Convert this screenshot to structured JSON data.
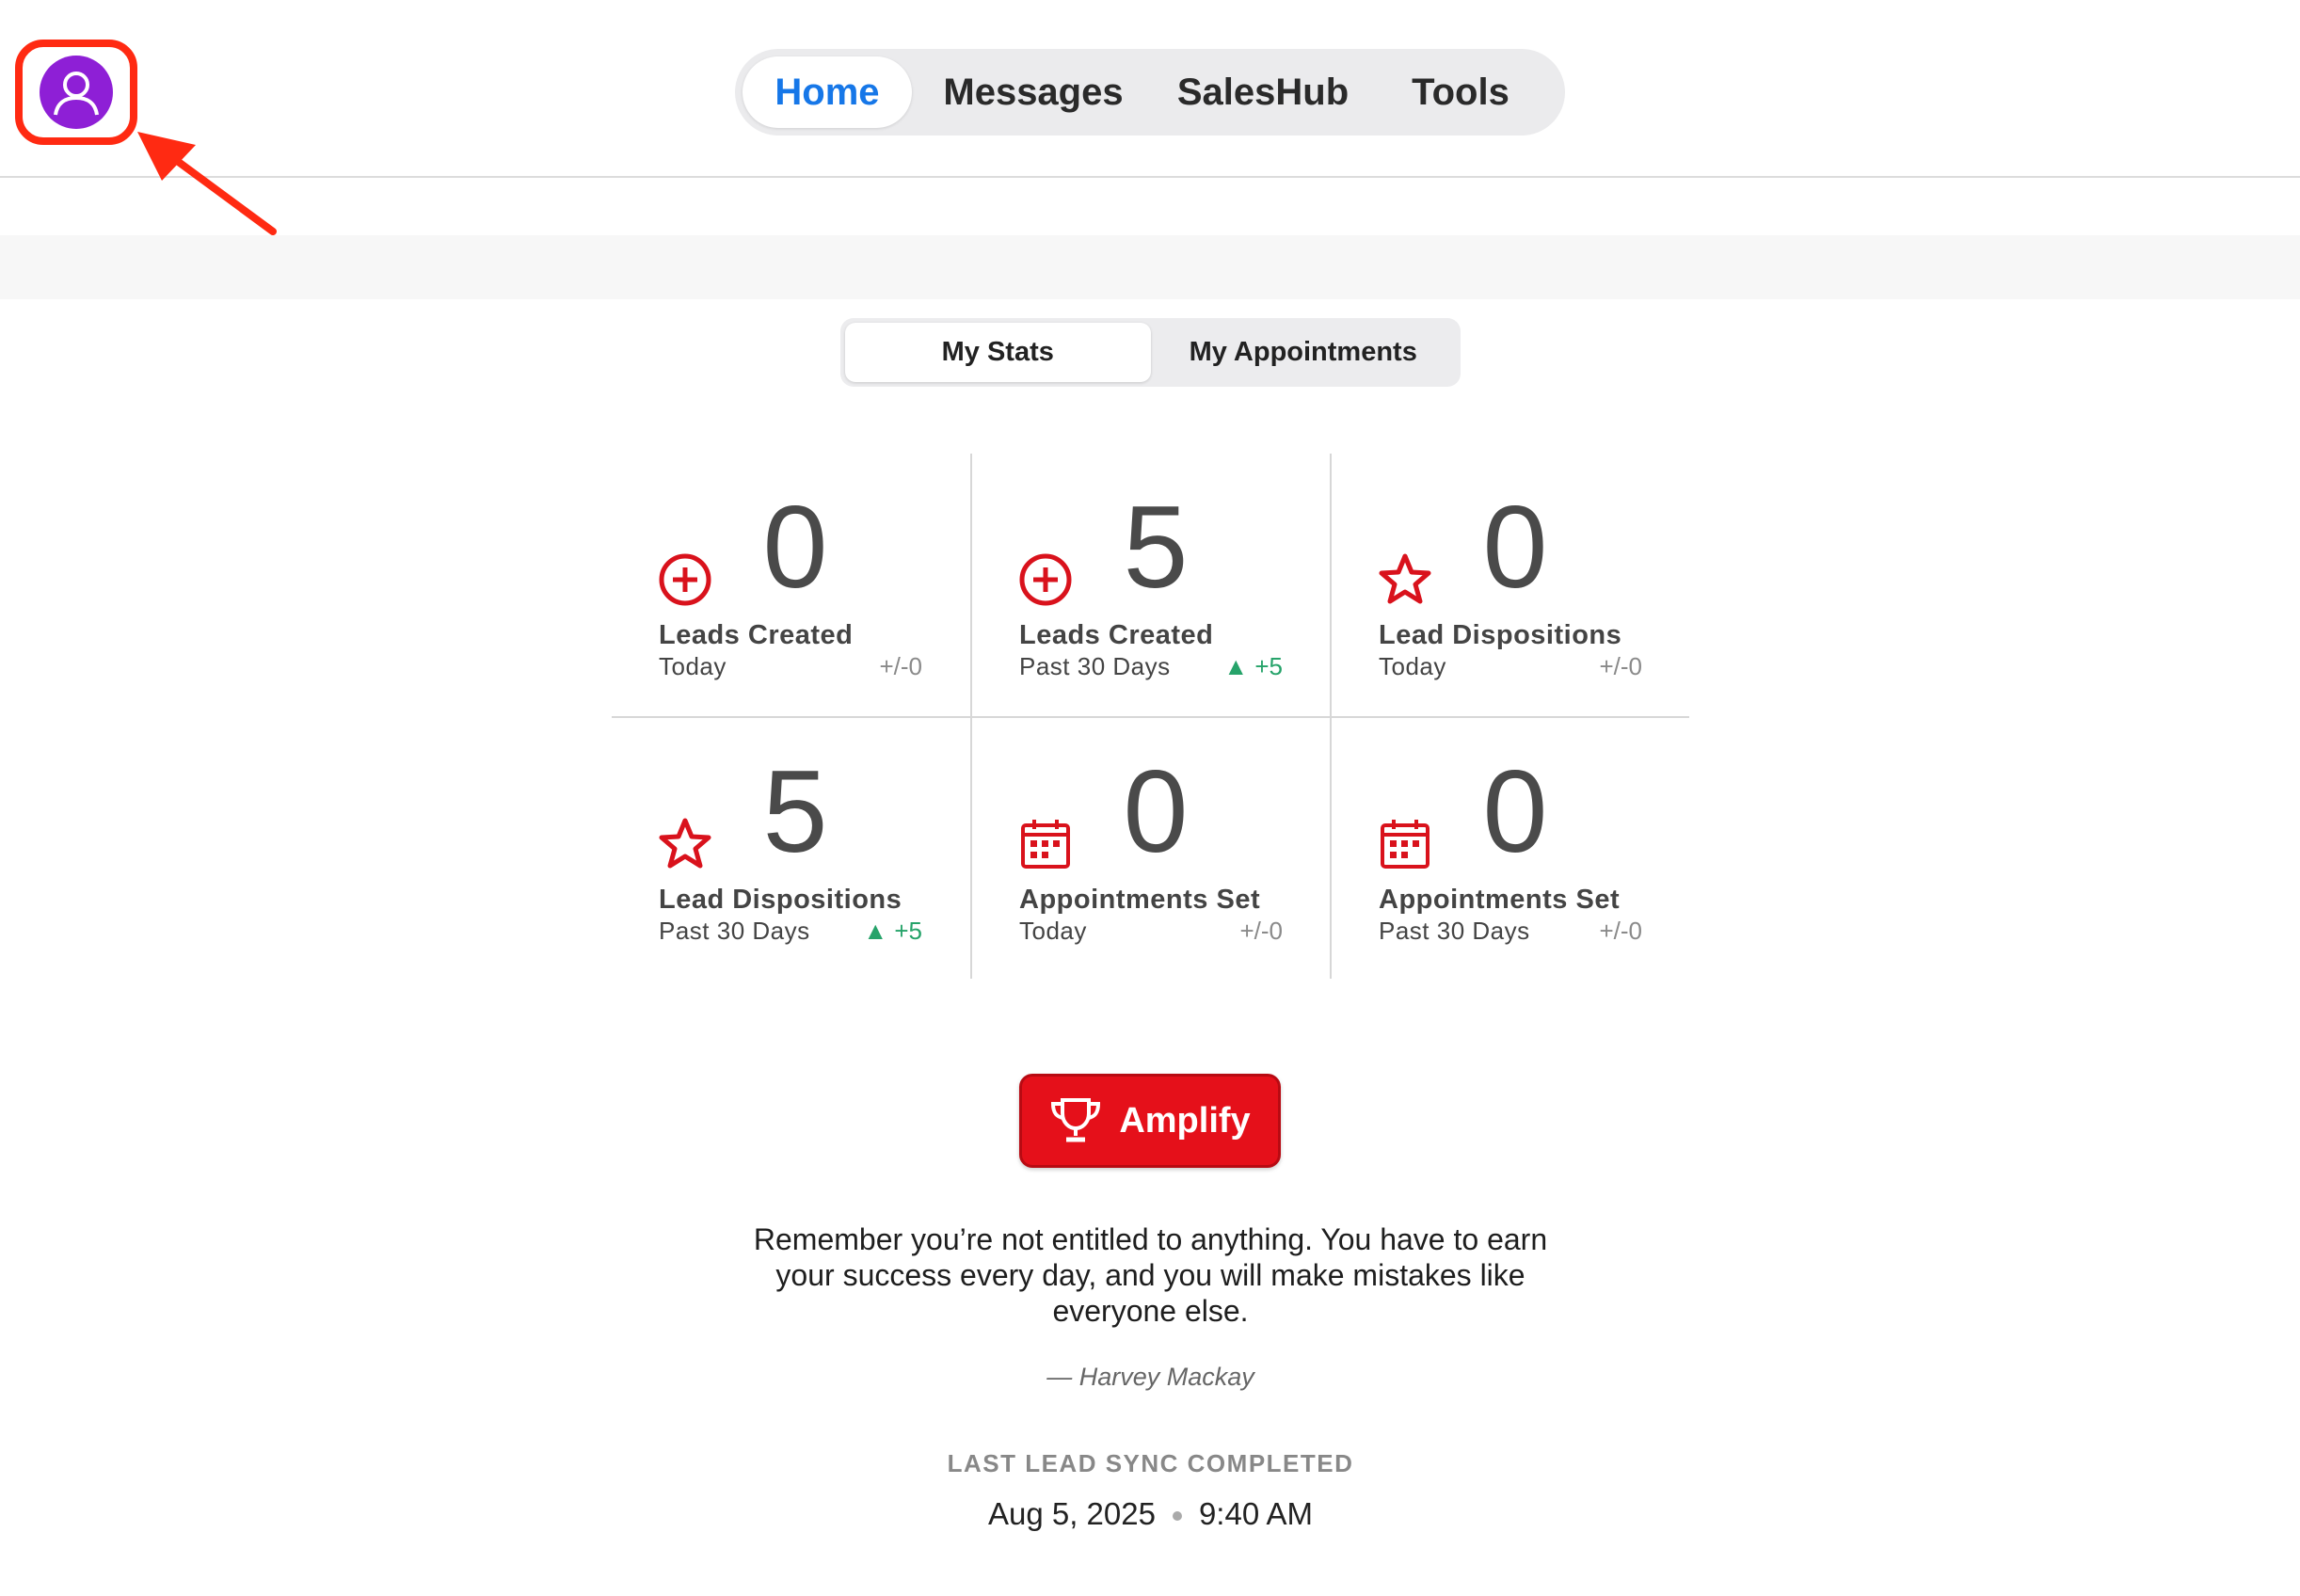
{
  "nav": {
    "items": [
      {
        "label": "Home",
        "active": true
      },
      {
        "label": "Messages"
      },
      {
        "label": "SalesHub"
      },
      {
        "label": "Tools"
      }
    ]
  },
  "avatar": {
    "icon": "user-avatar-icon",
    "color": "#8e1fd6",
    "highlight_color": "#ff2a12"
  },
  "segment": {
    "stats": "My Stats",
    "appointments": "My Appointments",
    "selected": "My Stats"
  },
  "stats": [
    {
      "icon": "plus-circle-icon",
      "value": "0",
      "label": "Leads Created",
      "period": "Today",
      "delta": "+/-0",
      "trend": "neutral"
    },
    {
      "icon": "plus-circle-icon",
      "value": "5",
      "label": "Leads Created",
      "period": "Past 30 Days",
      "delta": "+5",
      "trend": "up"
    },
    {
      "icon": "star-icon",
      "value": "0",
      "label": "Lead Dispositions",
      "period": "Today",
      "delta": "+/-0",
      "trend": "neutral"
    },
    {
      "icon": "star-icon",
      "value": "5",
      "label": "Lead Dispositions",
      "period": "Past 30 Days",
      "delta": "+5",
      "trend": "up"
    },
    {
      "icon": "calendar-icon",
      "value": "0",
      "label": "Appointments Set",
      "period": "Today",
      "delta": "+/-0",
      "trend": "neutral"
    },
    {
      "icon": "calendar-icon",
      "value": "0",
      "label": "Appointments Set",
      "period": "Past 30 Days",
      "delta": "+/-0",
      "trend": "neutral"
    }
  ],
  "amplify": {
    "label": "Amplify",
    "icon": "trophy-icon",
    "color": "#e5101a"
  },
  "quote": {
    "text": "Remember you’re not entitled to anything. You have to earn your success every day, and you will make mistakes like everyone else.",
    "author": "— Harvey Mackay"
  },
  "sync": {
    "title": "LAST LEAD SYNC COMPLETED",
    "date": "Aug 5, 2025",
    "time": "9:40 AM"
  },
  "colors": {
    "accent": "#1677e8",
    "icon_red": "#d9121c",
    "up_green": "#26a36a"
  }
}
